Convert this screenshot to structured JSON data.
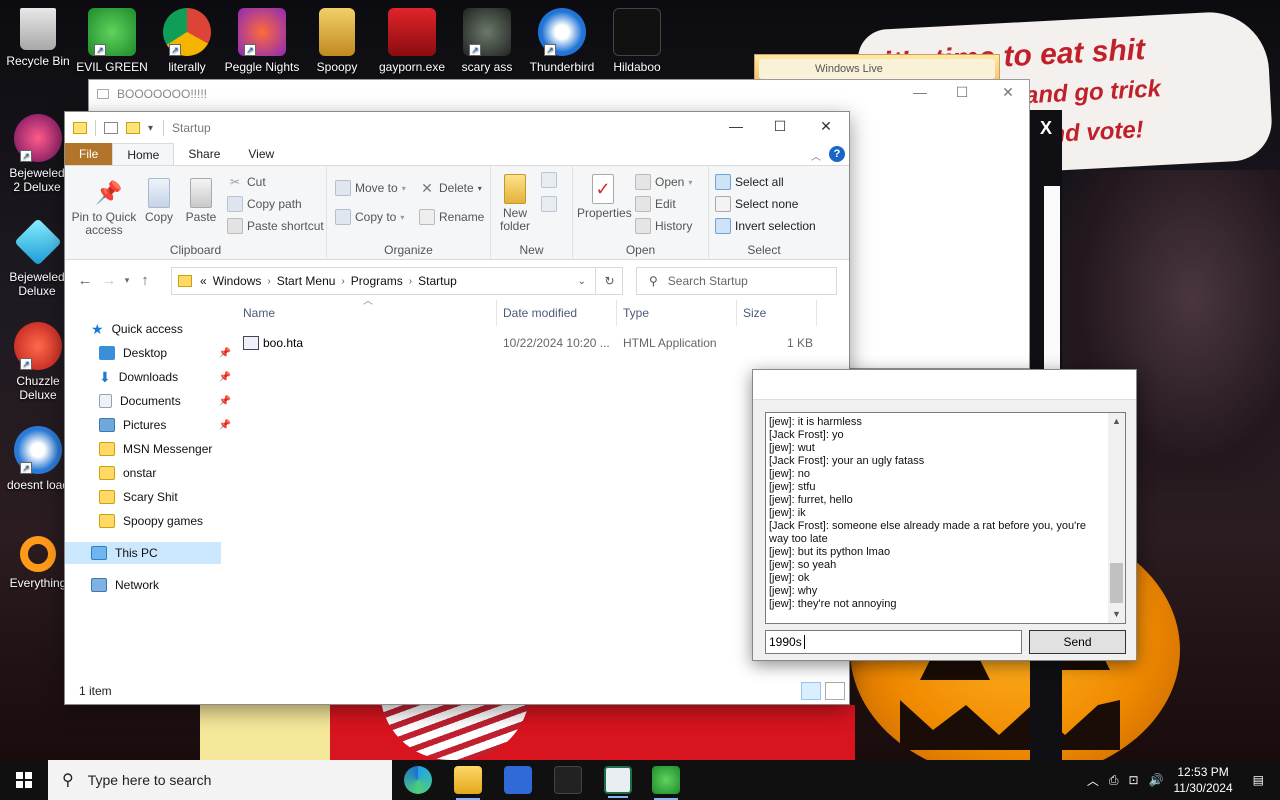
{
  "desktop": {
    "wallpaper_text_line1": "it's time to eat shit",
    "wallpaper_text_line2": "and go trick",
    "wallpaper_text_line3": "and vote!",
    "icons": [
      {
        "label": "Recycle Bin"
      },
      {
        "label": "EVIL GREEN MEN SO..."
      },
      {
        "label": "literally"
      },
      {
        "label": "Peggle Nights"
      },
      {
        "label": "Spoopy"
      },
      {
        "label": "gayporn.exe"
      },
      {
        "label": "scary ass"
      },
      {
        "label": "Thunderbird"
      },
      {
        "label": "Hildaboo"
      },
      {
        "label": "Bejeweled 2 Deluxe"
      },
      {
        "label": "Bejeweled Deluxe"
      },
      {
        "label": "Chuzzle Deluxe"
      },
      {
        "label": "doesnt load"
      },
      {
        "label": "Everything"
      }
    ]
  },
  "boo_window": {
    "title": "BOOOOOOO!!!!!"
  },
  "live_popup": {
    "text": "Windows Live"
  },
  "explorer": {
    "title": "Startup",
    "tabs": {
      "file": "File",
      "home": "Home",
      "share": "Share",
      "view": "View"
    },
    "ribbon": {
      "clipboard": {
        "label": "Clipboard",
        "pin": "Pin to Quick access",
        "copy": "Copy",
        "paste": "Paste",
        "cut": "Cut",
        "copy_path": "Copy path",
        "paste_shortcut": "Paste shortcut"
      },
      "organize": {
        "label": "Organize",
        "move_to": "Move to",
        "copy_to": "Copy to",
        "delete": "Delete",
        "rename": "Rename"
      },
      "new": {
        "label": "New",
        "new_folder": "New folder"
      },
      "open": {
        "label": "Open",
        "properties": "Properties",
        "open": "Open",
        "edit": "Edit",
        "history": "History"
      },
      "select": {
        "label": "Select",
        "select_all": "Select all",
        "select_none": "Select none",
        "invert": "Invert selection"
      }
    },
    "address": {
      "prefix": "«",
      "crumbs": [
        "Windows",
        "Start Menu",
        "Programs",
        "Startup"
      ]
    },
    "search_placeholder": "Search Startup",
    "nav": {
      "quick_access": "Quick access",
      "items": [
        "Desktop",
        "Downloads",
        "Documents",
        "Pictures",
        "MSN Messenger",
        "onstar",
        "Scary Shit",
        "Spoopy games"
      ],
      "this_pc": "This PC",
      "network": "Network"
    },
    "columns": {
      "name": "Name",
      "date": "Date modified",
      "type": "Type",
      "size": "Size"
    },
    "files": [
      {
        "name": "boo.hta",
        "date": "10/22/2024 10:20 ...",
        "type": "HTML Application",
        "size": "1 KB"
      }
    ],
    "status": "1 item"
  },
  "chat": {
    "lines": [
      "[jew]: it is harmless",
      "[Jack Frost]: yo",
      "[jew]: wut",
      "[Jack Frost]: your an ugly fatass",
      "[jew]: no",
      "[jew]: stfu",
      "[jew]: furret, hello",
      "[jew]: ik",
      "[Jack Frost]: someone else already made a rat before you, you're way too late",
      "[jew]: but its python lmao",
      "[jew]: so yeah",
      "[jew]: ok",
      "[jew]: why",
      "[jew]: they're not annoying"
    ],
    "input_value": "1990s",
    "send_label": "Send"
  },
  "taskbar": {
    "search_placeholder": "Type here to search",
    "time": "12:53 PM",
    "date": "11/30/2024"
  },
  "colors": {
    "file_tab": "#b0742a",
    "selection": "#cce8ff",
    "taskbar": "#101010"
  }
}
